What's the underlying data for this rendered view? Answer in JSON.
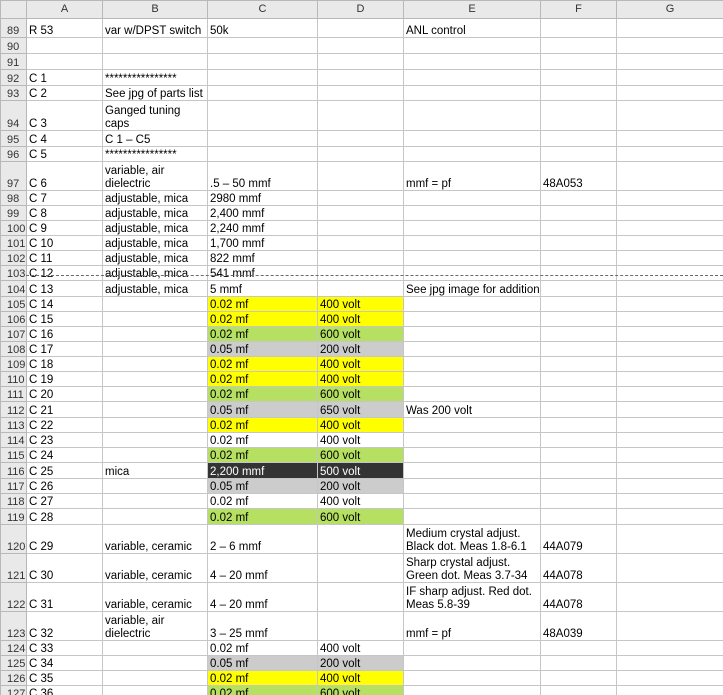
{
  "columns": [
    "A",
    "B",
    "C",
    "D",
    "E",
    "F",
    "G"
  ],
  "rows": [
    {
      "num": "89",
      "h": 19,
      "cells": [
        "R 53",
        "var w/DPST switch",
        "50k",
        "",
        "ANL control",
        "",
        ""
      ]
    },
    {
      "num": "90",
      "h": 16,
      "cells": [
        "",
        "",
        "",
        "",
        "",
        "",
        ""
      ]
    },
    {
      "num": "91",
      "h": 16,
      "cells": [
        "",
        "",
        "",
        "",
        "",
        "",
        ""
      ]
    },
    {
      "num": "92",
      "h": 16,
      "cells": [
        "C 1",
        "****************",
        "",
        "",
        "",
        "",
        ""
      ]
    },
    {
      "num": "93",
      "h": 15,
      "cells": [
        "C 2",
        "See jpg of parts list",
        "",
        "",
        "",
        "",
        ""
      ]
    },
    {
      "num": "94",
      "h": 30,
      "cells": [
        "C 3",
        "Ganged tuning caps",
        "",
        "",
        "",
        "",
        ""
      ]
    },
    {
      "num": "95",
      "h": 16,
      "cells": [
        "C 4",
        "C 1 – C5",
        "",
        "",
        "",
        "",
        ""
      ]
    },
    {
      "num": "96",
      "h": 15,
      "cells": [
        "C 5",
        "****************",
        "",
        "",
        "",
        "",
        ""
      ]
    },
    {
      "num": "97",
      "h": 29,
      "cells": [
        "C 6",
        "variable, air dielectric",
        ".5 – 50 mmf",
        "",
        "mmf = pf",
        "48A053",
        ""
      ]
    },
    {
      "num": "98",
      "h": 15,
      "cells": [
        "C 7",
        "adjustable, mica",
        "2980 mmf",
        "",
        "",
        "",
        ""
      ]
    },
    {
      "num": "99",
      "h": 15,
      "cells": [
        "C 8",
        "adjustable, mica",
        "2,400 mmf",
        "",
        "",
        "",
        ""
      ]
    },
    {
      "num": "100",
      "h": 15,
      "cells": [
        "C 9",
        "adjustable, mica",
        "2,240 mmf",
        "",
        "",
        "",
        ""
      ]
    },
    {
      "num": "101",
      "h": 15,
      "cells": [
        "C 10",
        "adjustable, mica",
        "1,700 mmf",
        "",
        "",
        "",
        ""
      ]
    },
    {
      "num": "102",
      "h": 15,
      "cells": [
        "C 11",
        "adjustable, mica",
        "822 mmf",
        "",
        "",
        "",
        ""
      ]
    },
    {
      "num": "103",
      "h": 15,
      "cells": [
        "C 12",
        "adjustable, mica",
        "541 mmf",
        "",
        "",
        "",
        ""
      ]
    },
    {
      "num": "104",
      "h": 16,
      "cells": [
        "C 13",
        "adjustable, mica",
        "5 mmf",
        "",
        "See jpg image for additional specs",
        "",
        ""
      ]
    },
    {
      "num": "105",
      "h": 15,
      "cells": [
        "C 14",
        "",
        "0.02 mf",
        "400 volt",
        "",
        "",
        ""
      ],
      "fill": "c-yellow"
    },
    {
      "num": "106",
      "h": 15,
      "cells": [
        "C 15",
        "",
        "0.02 mf",
        "400 volt",
        "",
        "",
        ""
      ],
      "fill": "c-yellow"
    },
    {
      "num": "107",
      "h": 15,
      "cells": [
        "C 16",
        "",
        "0.02 mf",
        "600 volt",
        "",
        "",
        ""
      ],
      "fill": "c-green"
    },
    {
      "num": "108",
      "h": 15,
      "cells": [
        "C 17",
        "",
        "0.05 mf",
        "200 volt",
        "",
        "",
        ""
      ],
      "fill": "c-gray"
    },
    {
      "num": "109",
      "h": 15,
      "cells": [
        "C 18",
        "",
        "0.02 mf",
        "400 volt",
        "",
        "",
        ""
      ],
      "fill": "c-yellow"
    },
    {
      "num": "110",
      "h": 15,
      "cells": [
        "C 19",
        "",
        "0.02 mf",
        "400 volt",
        "",
        "",
        ""
      ],
      "fill": "c-yellow"
    },
    {
      "num": "111",
      "h": 15,
      "cells": [
        "C 20",
        "",
        "0.02 mf",
        "600 volt",
        "",
        "",
        ""
      ],
      "fill": "c-green"
    },
    {
      "num": "112",
      "h": 16,
      "cells": [
        "C 21",
        "",
        "0.05 mf",
        "650 volt",
        "Was 200 volt",
        "",
        ""
      ],
      "fill": "c-gray"
    },
    {
      "num": "113",
      "h": 15,
      "cells": [
        "C 22",
        "",
        "0.02 mf",
        "400 volt",
        "",
        "",
        ""
      ],
      "fill": "c-yellow"
    },
    {
      "num": "114",
      "h": 15,
      "cells": [
        "C 23",
        "",
        "0.02 mf",
        "400 volt",
        "",
        "",
        ""
      ],
      "fill": ""
    },
    {
      "num": "115",
      "h": 15,
      "cells": [
        "C 24",
        "",
        "0.02 mf",
        "600 volt",
        "",
        "",
        ""
      ],
      "fill": "c-green"
    },
    {
      "num": "116",
      "h": 16,
      "cells": [
        "C 25",
        "mica",
        "2,200 mmf",
        "500 volt",
        "",
        "",
        ""
      ],
      "fill": "c-dark"
    },
    {
      "num": "117",
      "h": 15,
      "cells": [
        "C 26",
        "",
        "0.05 mf",
        "200 volt",
        "",
        "",
        ""
      ],
      "fill": "c-gray"
    },
    {
      "num": "118",
      "h": 15,
      "cells": [
        "C 27",
        "",
        "0.02 mf",
        "400 volt",
        "",
        "",
        ""
      ],
      "fill": ""
    },
    {
      "num": "119",
      "h": 16,
      "cells": [
        "C 28",
        "",
        "0.02 mf",
        "600 volt",
        "",
        "",
        ""
      ],
      "fill": "c-green"
    },
    {
      "num": "120",
      "h": 29,
      "cells": [
        "C 29",
        "variable, ceramic",
        "2 – 6 mmf",
        "",
        "Medium crystal adjust. Black dot. Meas 1.8-6.1",
        "44A079",
        ""
      ]
    },
    {
      "num": "121",
      "h": 29,
      "cells": [
        "C 30",
        "variable, ceramic",
        "4 – 20 mmf",
        "",
        "Sharp crystal adjust. Green dot. Meas 3.7-34",
        "44A078",
        ""
      ]
    },
    {
      "num": "122",
      "h": 29,
      "cells": [
        "C 31",
        "variable, ceramic",
        "4 – 20 mmf",
        "",
        "IF sharp adjust. Red dot. Meas 5.8-39",
        "44A078",
        ""
      ]
    },
    {
      "num": "123",
      "h": 29,
      "cells": [
        "C 32",
        "variable, air dielectric",
        "3 – 25 mmf",
        "",
        "mmf = pf",
        "48A039",
        ""
      ]
    },
    {
      "num": "124",
      "h": 15,
      "cells": [
        "C 33",
        "",
        "0.02 mf",
        "400 volt",
        "",
        "",
        ""
      ],
      "fill": ""
    },
    {
      "num": "125",
      "h": 15,
      "cells": [
        "C 34",
        "",
        "0.05 mf",
        "200 volt",
        "",
        "",
        ""
      ],
      "fill": "c-gray"
    },
    {
      "num": "126",
      "h": 15,
      "cells": [
        "C 35",
        "",
        "0.02 mf",
        "400 volt",
        "",
        "",
        ""
      ],
      "fill": "c-yellow"
    },
    {
      "num": "127",
      "h": 15,
      "cells": [
        "C 36",
        "",
        "0.02 mf",
        "600 volt",
        "",
        "",
        ""
      ],
      "fill": "c-green"
    }
  ],
  "colors": {
    "yellow": "#ffff00",
    "green": "#b5e061",
    "gray": "#cccccc",
    "dark": "#333333"
  }
}
